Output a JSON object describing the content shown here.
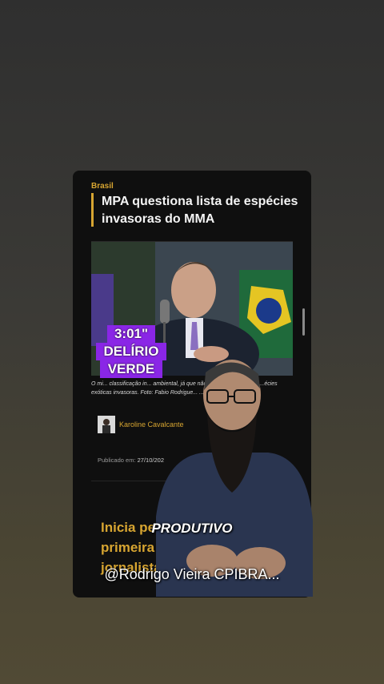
{
  "article": {
    "category": "Brasil",
    "title": "MPA questiona lista de espécies invasoras do MMA",
    "caption": "O mi... classificação in... ambiental, já que não há legislação fede... ...écies exóticas invasoras. Foto: Fabio Rodrigue... ...a Brasil.",
    "author": "Karoline Cavalcante",
    "published_label": "Publicado em:",
    "published_date": "27/10/202",
    "next_headline": "Inicia petista f primeira m jornalista C"
  },
  "overlay": {
    "timer": "3:01\"",
    "tag_line1": "DELÍRIO",
    "tag_line2": "VERDE",
    "subtitle": "PRODUTIVO",
    "handle": "@Rodrigo Vieira CPIBRA..."
  },
  "colors": {
    "accent": "#d7a531",
    "badge": "#8a26e6",
    "card_bg": "#0f0f0f"
  }
}
